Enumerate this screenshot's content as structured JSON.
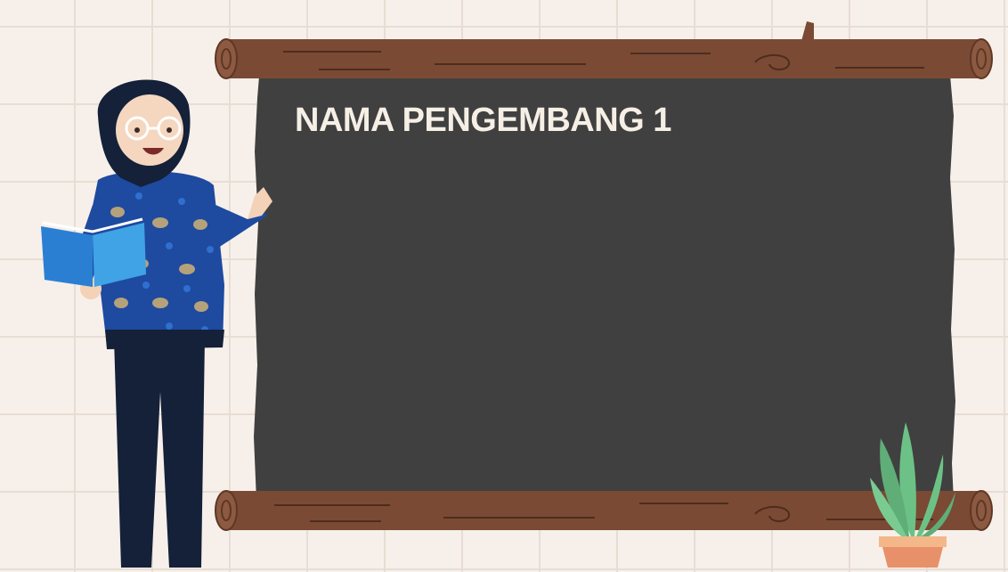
{
  "slide": {
    "title": "NAMA PENGEMBANG 1"
  },
  "colors": {
    "background": "#f7f0ea",
    "grid_lines": "#e8ddd3",
    "chalkboard": "#404040",
    "wood": "#7a4a34",
    "title_text": "#f6efe6"
  },
  "illustrations": {
    "teacher": "teacher-illustration",
    "chalkboard": "chalkboard",
    "plant": "potted-plant"
  }
}
